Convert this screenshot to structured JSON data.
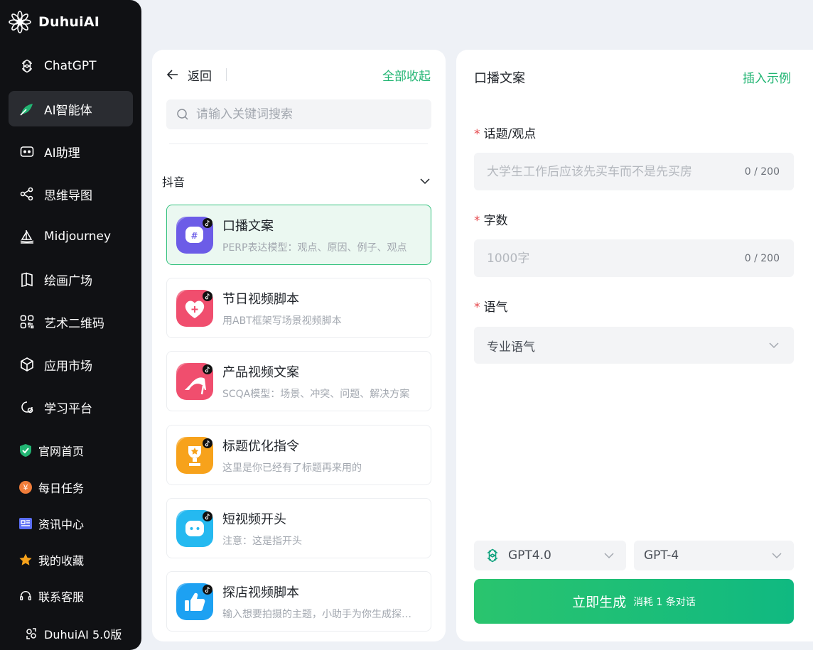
{
  "brand": {
    "name": "DuhuiAI"
  },
  "sidebar": {
    "items": [
      {
        "label": "ChatGPT",
        "icon": "openai-icon"
      },
      {
        "label": "AI智能体",
        "icon": "agent-icon",
        "active": true
      },
      {
        "label": "AI助理",
        "icon": "robot-icon"
      },
      {
        "label": "思维导图",
        "icon": "mindmap-icon"
      },
      {
        "label": "Midjourney",
        "icon": "sailboat-icon"
      },
      {
        "label": "绘画广场",
        "icon": "map-icon"
      },
      {
        "label": "艺术二维码",
        "icon": "qrcode-icon"
      },
      {
        "label": "应用市场",
        "icon": "cube-icon"
      },
      {
        "label": "学习平台",
        "icon": "learn-icon"
      }
    ],
    "sub_items": [
      {
        "label": "官网首页",
        "icon": "shield-check-icon"
      },
      {
        "label": "每日任务",
        "icon": "coin-icon"
      },
      {
        "label": "资讯中心",
        "icon": "news-icon"
      },
      {
        "label": "我的收藏",
        "icon": "star-icon"
      },
      {
        "label": "联系客服",
        "icon": "headset-icon"
      }
    ],
    "version": "DuhuiAI 5.0版"
  },
  "middle": {
    "back_label": "返回",
    "collapse_all": "全部收起",
    "search_placeholder": "请输入关键词搜索",
    "category": "抖音",
    "cards": [
      {
        "title": "口播文案",
        "desc": "PERP表达模型：观点、原因、例子、观点",
        "color": "#6c5ce7",
        "active": true
      },
      {
        "title": "节日视频脚本",
        "desc": "用ABT框架写场景视频脚本",
        "color": "#f04e6e"
      },
      {
        "title": "产品视频文案",
        "desc": "SCQA模型：场景、冲突、问题、解决方案",
        "color": "#f04e6e"
      },
      {
        "title": "标题优化指令",
        "desc": "这里是你已经有了标题再来用的",
        "color": "#f7a21b"
      },
      {
        "title": "短视频开头",
        "desc": "注意：这是指开头",
        "color": "#25b9f0"
      },
      {
        "title": "探店视频脚本",
        "desc": "输入想要拍摄的主题，小助手为你生成探店视频脚本",
        "color": "#1da1f2"
      }
    ]
  },
  "form": {
    "title": "口播文案",
    "insert_example": "插入示例",
    "fields": [
      {
        "label": "话题/观点",
        "placeholder": "大学生工作后应该先买车而不是先买房",
        "counter": "0 / 200"
      },
      {
        "label": "字数",
        "placeholder": "1000字",
        "counter": "0 / 200"
      },
      {
        "label": "语气",
        "value": "专业语气"
      }
    ],
    "model_left": "GPT4.0",
    "model_right": "GPT-4",
    "generate": {
      "label": "立即生成",
      "sub": "消耗 1 条对话"
    }
  },
  "colors": {
    "accent": "#22b573",
    "sidebar_bg": "#101114",
    "page_bg": "#eef1f6"
  }
}
